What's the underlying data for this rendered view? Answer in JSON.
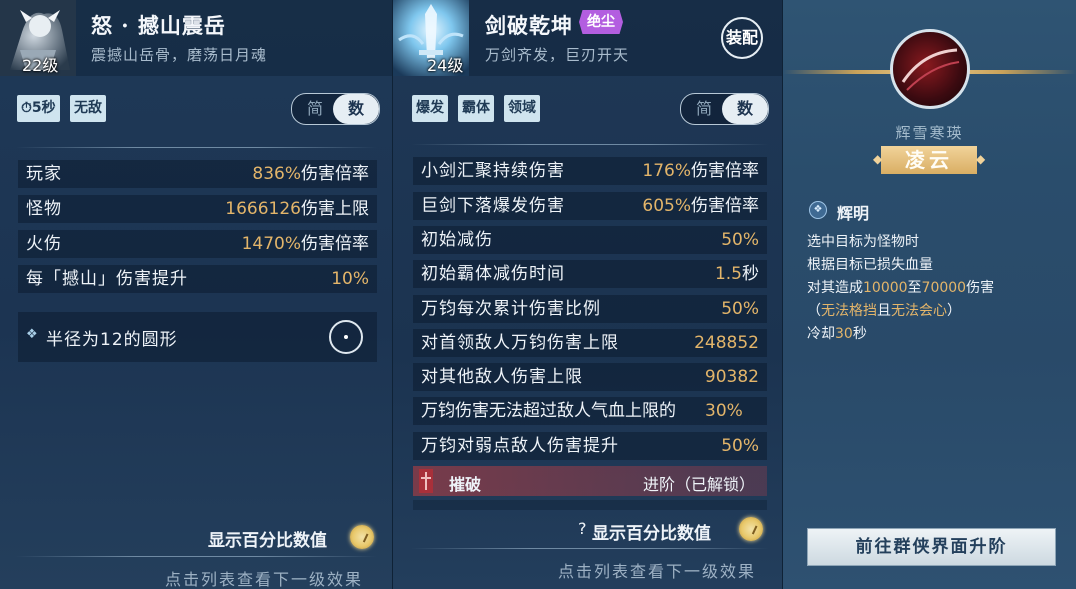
{
  "colors": {
    "accent_gold": "#e3b56a",
    "panel_bg": "#1d3450",
    "badge_purple": "#b35ee0"
  },
  "panel1": {
    "level": "22级",
    "title": "怒 · 撼山震岳",
    "subtitle": "震撼山岳骨，磨荡日月魂",
    "tags": [
      "⏱5秒",
      "无敌"
    ],
    "toggle": {
      "simple": "简",
      "detail": "数"
    },
    "rows": [
      {
        "label": "玩家",
        "value_num": "836%",
        "value_unit": "伤害倍率"
      },
      {
        "label": "怪物",
        "value_num": "1666126",
        "value_unit": "伤害上限"
      },
      {
        "label": "火伤",
        "value_num": "1470%",
        "value_unit": "伤害倍率"
      },
      {
        "label": "每「撼山」伤害提升",
        "value_num": "10%",
        "value_unit": ""
      }
    ],
    "range_text": "半径为12的圆形",
    "show_percent": "显示百分比数值",
    "footer": "点击列表查看下一级效果"
  },
  "panel2": {
    "level": "24级",
    "title": "剑破乾坤",
    "badge": "绝尘",
    "subtitle": "万剑齐发，巨刃开天",
    "equip_label": "装配",
    "tags": [
      "爆发",
      "霸体",
      "领域"
    ],
    "toggle": {
      "simple": "简",
      "detail": "数"
    },
    "rows": [
      {
        "label": "小剑汇聚持续伤害",
        "value_num": "176%",
        "value_unit": "伤害倍率"
      },
      {
        "label": "巨剑下落爆发伤害",
        "value_num": "605%",
        "value_unit": "伤害倍率"
      },
      {
        "label": "初始减伤",
        "value_num": "50%",
        "value_unit": ""
      },
      {
        "label": "初始霸体减伤时间",
        "value_num": "1.5",
        "value_unit": "秒"
      },
      {
        "label": "万钧每次累计伤害比例",
        "value_num": "50%",
        "value_unit": ""
      },
      {
        "label": "对首领敌人万钧伤害上限",
        "value_num": "248852",
        "value_unit": ""
      },
      {
        "label": "对其他敌人伤害上限",
        "value_num": "90382",
        "value_unit": ""
      },
      {
        "label": "万钧伤害无法超过敌人气血上限的",
        "value_num": "30%",
        "value_unit": ""
      },
      {
        "label": "万钧对弱点敌人伤害提升",
        "value_num": "50%",
        "value_unit": ""
      }
    ],
    "advance": {
      "label": "摧破",
      "status": "进阶（已解锁）"
    },
    "show_percent": "显示百分比数值",
    "help": "?",
    "footer": "点击列表查看下一级效果"
  },
  "panel3": {
    "series": "辉雪寒瑛",
    "name": "凌云",
    "ability_name": "辉明",
    "desc": [
      {
        "parts": [
          {
            "t": "选中目标为怪物时",
            "hl": false
          }
        ]
      },
      {
        "parts": [
          {
            "t": "根据目标已损失血量",
            "hl": false
          }
        ]
      },
      {
        "parts": [
          {
            "t": "对其造成",
            "hl": false
          },
          {
            "t": "10000",
            "hl": true
          },
          {
            "t": "至",
            "hl": false
          },
          {
            "t": "70000",
            "hl": true
          },
          {
            "t": "伤害",
            "hl": false
          }
        ]
      },
      {
        "parts": [
          {
            "t": "（",
            "hl": false
          },
          {
            "t": "无法格挡",
            "hl": true
          },
          {
            "t": "且",
            "hl": false
          },
          {
            "t": "无法会心",
            "hl": true
          },
          {
            "t": "）",
            "hl": false
          }
        ]
      },
      {
        "parts": [
          {
            "t": "冷却",
            "hl": false
          },
          {
            "t": "30",
            "hl": true
          },
          {
            "t": "秒",
            "hl": false
          }
        ]
      }
    ],
    "button": "前往群侠界面升阶"
  }
}
